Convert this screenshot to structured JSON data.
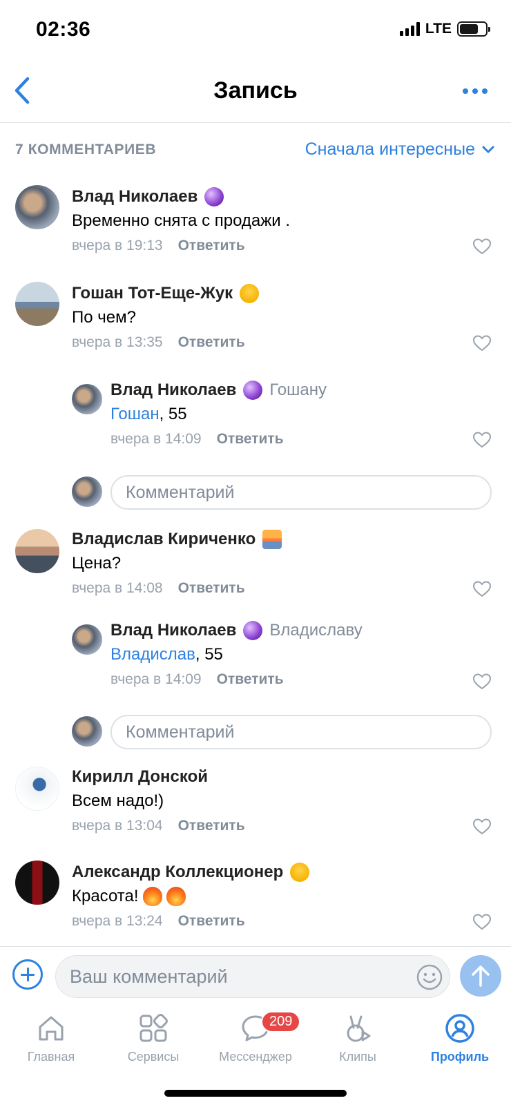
{
  "status_bar": {
    "time": "02:36",
    "network": "LTE"
  },
  "header": {
    "title": "Запись"
  },
  "comments_header": {
    "count": "7 КОММЕНТАРИЕВ",
    "sort": "Сначала интересные"
  },
  "comments": [
    {
      "author": "Влад Николаев",
      "text": "Временно снята с продажи .",
      "time": "вчера в 19:13",
      "reply": "Ответить"
    },
    {
      "author": "Гошан Тот-Еще-Жук",
      "text": "По чем?",
      "time": "вчера в 13:35",
      "reply": "Ответить",
      "thread": {
        "author": "Влад Николаев",
        "to": "Гошану",
        "ref": "Гошан",
        "text": ", 55",
        "time": "вчера в 14:09",
        "reply": "Ответить"
      }
    },
    {
      "author": "Владислав Кириченко",
      "text": "Цена?",
      "time": "вчера в 14:08",
      "reply": "Ответить",
      "thread": {
        "author": "Влад Николаев",
        "to": "Владиславу",
        "ref": "Владислав",
        "text": ", 55",
        "time": "вчера в 14:09",
        "reply": "Ответить"
      }
    },
    {
      "author": "Кирилл Донской",
      "text": "Всем надо!)",
      "time": "вчера в 13:04",
      "reply": "Ответить"
    },
    {
      "author": "Александр Коллекционер",
      "text": "Красота!",
      "time": "вчера в 13:24",
      "reply": "Ответить"
    }
  ],
  "reply_field": {
    "placeholder": "Комментарий"
  },
  "composer": {
    "placeholder": "Ваш комментарий"
  },
  "tabbar": {
    "tabs": [
      {
        "label": "Главная",
        "icon": "home-icon"
      },
      {
        "label": "Сервисы",
        "icon": "services-icon"
      },
      {
        "label": "Мессенджер",
        "icon": "messenger-icon",
        "badge": "209"
      },
      {
        "label": "Клипы",
        "icon": "clips-icon"
      },
      {
        "label": "Профиль",
        "icon": "profile-icon",
        "active": true
      }
    ]
  },
  "colors": {
    "accent": "#2d81e0",
    "secondary": "#818c99",
    "badge": "#e64646",
    "send_disabled": "#99c1f0"
  }
}
